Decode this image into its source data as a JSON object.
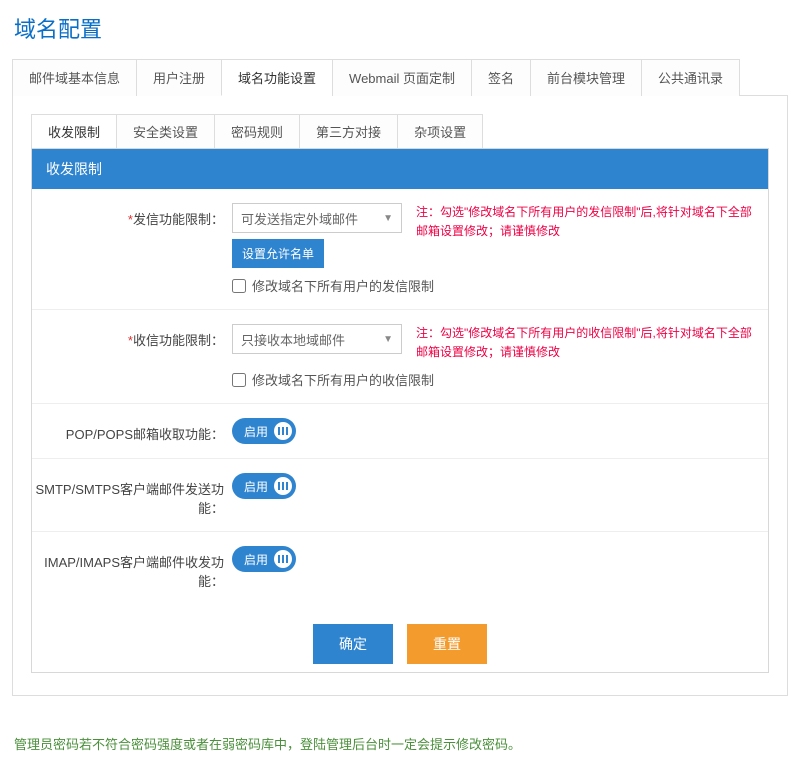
{
  "page_title": "域名配置",
  "main_tabs": [
    "邮件域基本信息",
    "用户注册",
    "域名功能设置",
    "Webmail 页面定制",
    "签名",
    "前台模块管理",
    "公共通讯录"
  ],
  "main_tab_active": 2,
  "sub_tabs": [
    "收发限制",
    "安全类设置",
    "密码规则",
    "第三方对接",
    "杂项设置"
  ],
  "sub_tab_active": 0,
  "panel_title": "收发限制",
  "rows": {
    "send": {
      "label": "发信功能限制：",
      "required": true,
      "select_value": "可发送指定外域邮件",
      "config_btn": "设置允许名单",
      "checkbox_label": "修改域名下所有用户的发信限制",
      "note": "注：勾选\"修改域名下所有用户的发信限制\"后,将针对域名下全部邮箱设置修改；请谨慎修改"
    },
    "recv": {
      "label": "收信功能限制：",
      "required": true,
      "select_value": "只接收本地域邮件",
      "checkbox_label": "修改域名下所有用户的收信限制",
      "note": "注：勾选\"修改域名下所有用户的收信限制\"后,将针对域名下全部邮箱设置修改；请谨慎修改"
    },
    "pop": {
      "label": "POP/POPS邮箱收取功能：",
      "toggle": "启用"
    },
    "smtp": {
      "label": "SMTP/SMTPS客户端邮件发送功能：",
      "toggle": "启用"
    },
    "imap": {
      "label": "IMAP/IMAPS客户端邮件收发功能：",
      "toggle": "启用"
    }
  },
  "buttons": {
    "confirm": "确定",
    "reset": "重置"
  },
  "footer_note": "管理员密码若不符合密码强度或者在弱密码库中，登陆管理后台时一定会提示修改密码。"
}
